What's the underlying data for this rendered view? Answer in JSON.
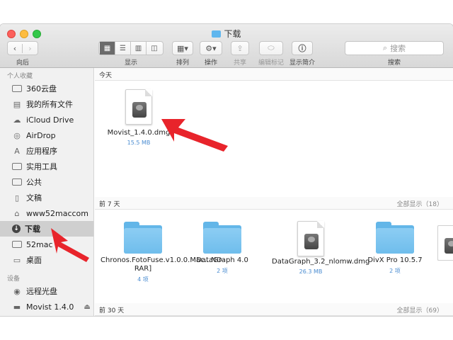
{
  "window": {
    "title": "下载"
  },
  "toolbar": {
    "nav_label": "向后",
    "view_label": "显示",
    "arrange_label": "排列",
    "action_label": "操作",
    "share_label": "共享",
    "edit_tags_label": "编辑标记",
    "info_label": "显示简介",
    "search_label": "搜索",
    "search_placeholder": "搜索"
  },
  "sidebar": {
    "favorites_header": "个人收藏",
    "items": [
      {
        "label": "360云盘",
        "icon": "folder-icon"
      },
      {
        "label": "我的所有文件",
        "icon": "all-files-icon"
      },
      {
        "label": "iCloud Drive",
        "icon": "cloud-icon"
      },
      {
        "label": "AirDrop",
        "icon": "airdrop-icon"
      },
      {
        "label": "应用程序",
        "icon": "applications-icon"
      },
      {
        "label": "实用工具",
        "icon": "folder-icon"
      },
      {
        "label": "公共",
        "icon": "folder-icon"
      },
      {
        "label": "文稿",
        "icon": "documents-icon"
      },
      {
        "label": "www52maccom",
        "icon": "home-icon"
      },
      {
        "label": "下载",
        "icon": "download-icon",
        "selected": true
      },
      {
        "label": "52mac",
        "icon": "folder-icon"
      },
      {
        "label": "桌面",
        "icon": "desktop-icon"
      }
    ],
    "devices_header": "设备",
    "devices": [
      {
        "label": "远程光盘",
        "icon": "disc-icon"
      },
      {
        "label": "Movist 1.4.0",
        "icon": "disk-icon"
      }
    ]
  },
  "sections": {
    "today": {
      "title": "今天",
      "files": [
        {
          "name": "Movist_1.4.0.dmg",
          "sub": "15.5 MB",
          "type": "dmg"
        }
      ]
    },
    "week": {
      "title": "前 7 天",
      "show_all": "全部显示（18）",
      "files": [
        {
          "name": "Chronos.FotoFuse.v1.0.0.Mac...NO-RAR]",
          "sub": "4 项",
          "type": "folder"
        },
        {
          "name": "DataGraph 4.0",
          "sub": "2 项",
          "type": "folder"
        },
        {
          "name": "DataGraph_3.2_nlomw.dmg",
          "sub": "26.3 MB",
          "type": "dmg"
        },
        {
          "name": "DivX Pro 10.5.7",
          "sub": "2 项",
          "type": "folder"
        }
      ]
    },
    "month": {
      "title": "前 30 天",
      "show_all": "全部显示（69）"
    }
  },
  "colors": {
    "accent": "#4a8cd1",
    "arrow": "#e8242b",
    "folder": "#63b6e8"
  }
}
